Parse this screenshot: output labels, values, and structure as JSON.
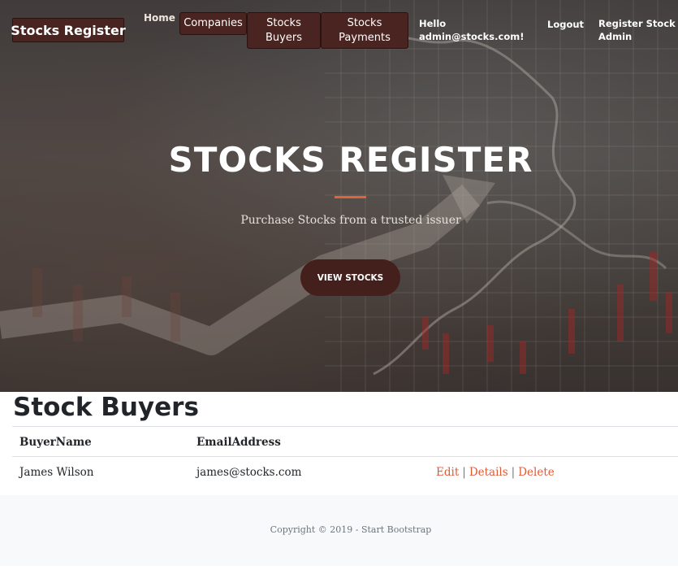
{
  "navbar": {
    "brand": "Stocks Register",
    "home": "Home",
    "companies": "Companies",
    "buyers": "Stocks Buyers",
    "payments": "Stocks Payments",
    "hello": "Hello admin@stocks.com!",
    "logout": "Logout",
    "register": "Register Stock Admin"
  },
  "hero": {
    "title": "STOCKS REGISTER",
    "subtitle": "Purchase Stocks from a trusted issuer",
    "button": "VIEW STOCKS"
  },
  "main": {
    "title": "Stock Buyers",
    "columns": [
      "BuyerName",
      "EmailAddress"
    ],
    "rows": [
      {
        "name": "James Wilson",
        "email": "james@stocks.com",
        "edit": "Edit",
        "details": "Details",
        "delete": "Delete"
      }
    ]
  },
  "footer": {
    "copyright": "Copyright © 2019 - Start Bootstrap"
  },
  "colors": {
    "accent": "#e05a36",
    "button": "#43201c",
    "navButton": "#4a2420"
  }
}
